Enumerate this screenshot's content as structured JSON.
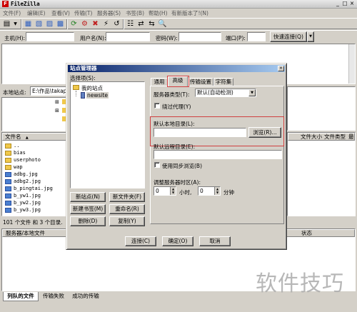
{
  "app": {
    "title": "FileZilla",
    "min": "_",
    "max": "□",
    "close": "×"
  },
  "menu": [
    "文件(F)",
    "编辑(E)",
    "查看(V)",
    "传输(T)",
    "服务器(S)",
    "书签(B)",
    "帮助(H)",
    "有新版本了!(N)"
  ],
  "quickconnect": {
    "host_label": "主机(H):",
    "user_label": "用户名(N):",
    "pass_label": "密码(W):",
    "port_label": "端口(P):",
    "button": "快速连接(Q)",
    "dropdown": "▼"
  },
  "local": {
    "site_label": "本地站点:",
    "site_path": "E:\\作品\\takaph",
    "col_filename": "文件名",
    "sort_arrow": "▲",
    "files": [
      {
        "name": "..",
        "type": "folder"
      },
      {
        "name": "bias",
        "type": "folder"
      },
      {
        "name": "userphoto",
        "type": "folder"
      },
      {
        "name": "wap",
        "type": "folder"
      },
      {
        "name": "adbg.jpg",
        "type": "jpg"
      },
      {
        "name": "adbg2.jpg",
        "type": "jpg"
      },
      {
        "name": "b_pingtai.jpg",
        "type": "jpg"
      },
      {
        "name": "b_yw1.jpg",
        "type": "jpg"
      },
      {
        "name": "b_yw2.jpg",
        "type": "jpg"
      },
      {
        "name": "b_yw3.jpg",
        "type": "jpg"
      }
    ],
    "status": "101 个文件 和 3 个目录."
  },
  "remote": {
    "col_size": "文件大小",
    "col_type": "文件类型",
    "col_last": "最"
  },
  "queue": {
    "col_server": "服务器/本地文件",
    "col_status": "状态"
  },
  "bottom_tabs": [
    "列队的文件",
    "传输失败",
    "成功的传输"
  ],
  "dialog": {
    "title": "站点管理器",
    "select_label": "选择项(S):",
    "tree_root": "我的站点",
    "tree_child": "newsite",
    "tabs": [
      "通用",
      "高级",
      "传输设置",
      "字符集"
    ],
    "server_type_label": "服务器类型(T):",
    "server_type_value": "默认(自动检测)",
    "bypass_proxy": "绕过代理(Y)",
    "local_dir_label": "默认本地目录(L):",
    "local_dir_value": "",
    "browse": "浏览(R)...",
    "remote_dir_label": "默认远程目录(E):",
    "remote_dir_value": "",
    "sync_browse": "使用同步浏览(B)",
    "tz_label": "调整服务器时区(A):",
    "hours_value": "0",
    "hours_label": "小时,",
    "minutes_value": "0",
    "minutes_label": "分钟",
    "btn_new_site": "新站点(N)",
    "btn_new_folder": "新文件夹(F)",
    "btn_new_bookmark": "新建书签(M)",
    "btn_rename": "重命名(R)",
    "btn_delete": "删除(D)",
    "btn_copy": "复制(Y)",
    "btn_connect": "连接(C)",
    "btn_ok": "确定(O)",
    "btn_cancel": "取消",
    "highlight_color": "#d04040"
  },
  "watermark": "软件技巧"
}
